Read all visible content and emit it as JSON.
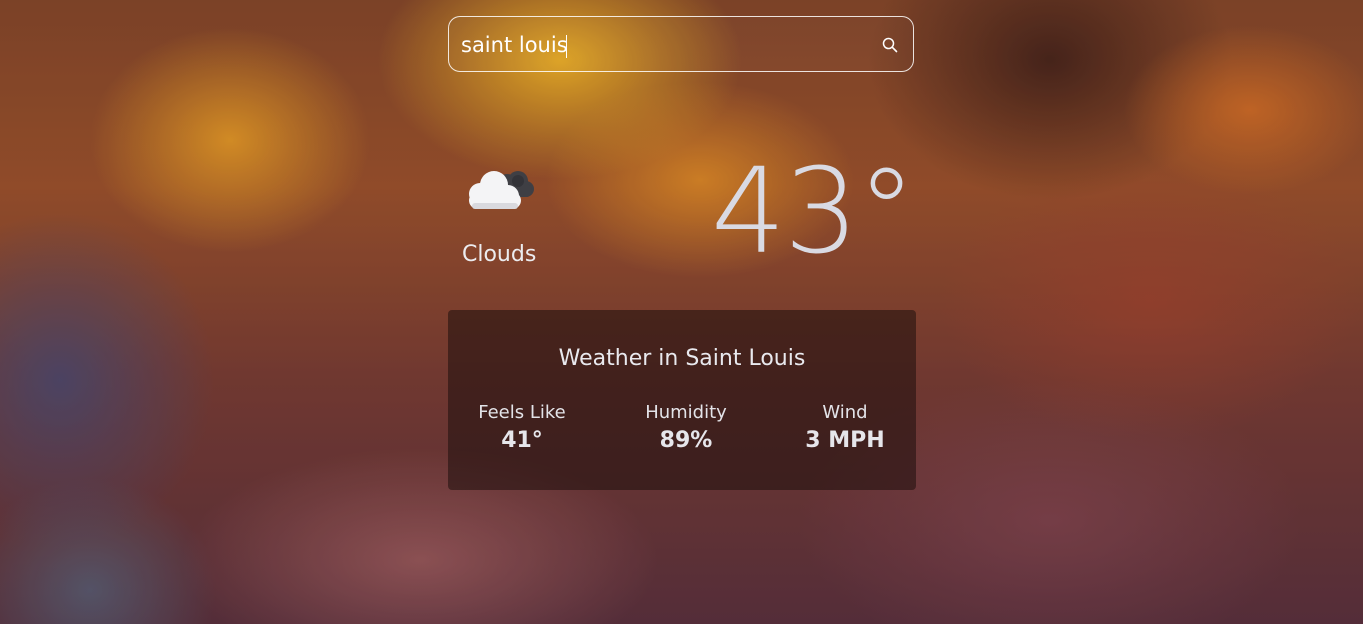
{
  "search": {
    "value": "saint louis",
    "placeholder": ""
  },
  "current": {
    "condition": "Clouds",
    "condition_icon": "cloud-icon",
    "temperature": "43°"
  },
  "details": {
    "title": "Weather in Saint Louis",
    "stats": [
      {
        "label": "Feels Like",
        "value": "41°"
      },
      {
        "label": "Humidity",
        "value": "89%"
      },
      {
        "label": "Wind",
        "value": "3 MPH"
      }
    ]
  },
  "colors": {
    "text": "#ececef",
    "temperature": "#d9dae3",
    "panel": "#1e0e0c"
  }
}
